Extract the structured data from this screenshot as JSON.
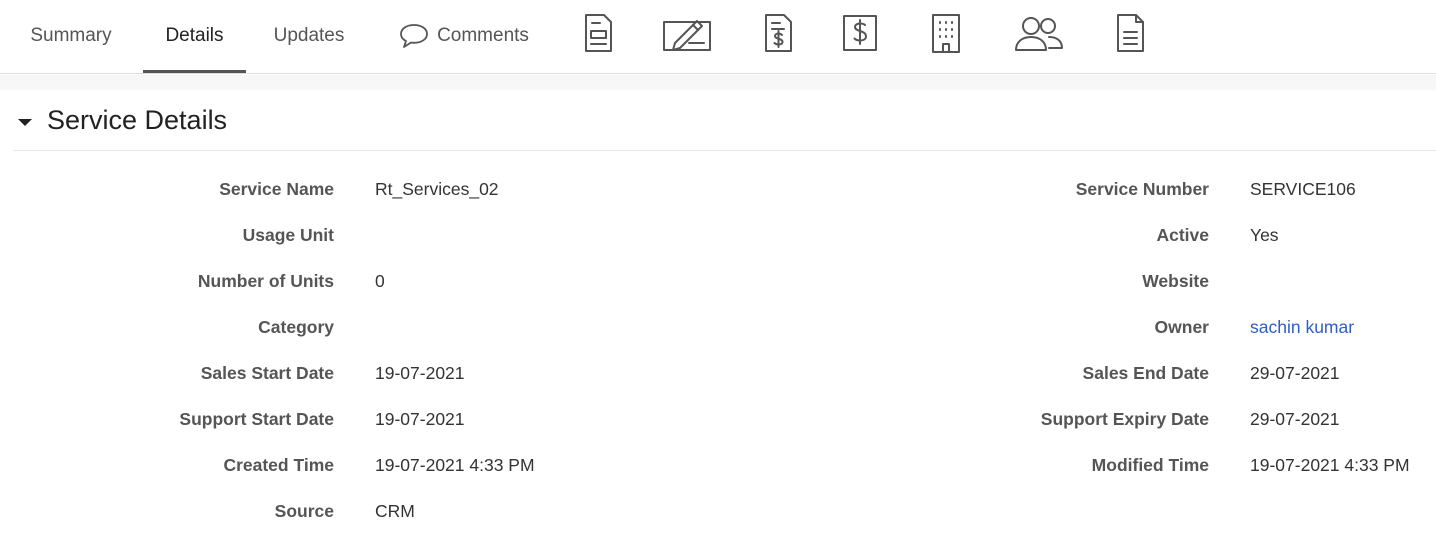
{
  "tabs": {
    "summary": "Summary",
    "details": "Details",
    "updates": "Updates",
    "comments": "Comments"
  },
  "icon_tabs": [
    "quote-document-icon",
    "signature-icon",
    "invoice-icon",
    "dollar-icon",
    "building-icon",
    "contacts-icon",
    "document-icon"
  ],
  "section": {
    "title": "Service Details"
  },
  "left_fields": [
    {
      "label": "Service Name",
      "value": "Rt_Services_02"
    },
    {
      "label": "Usage Unit",
      "value": ""
    },
    {
      "label": "Number of Units",
      "value": "0"
    },
    {
      "label": "Category",
      "value": ""
    },
    {
      "label": "Sales Start Date",
      "value": "19-07-2021"
    },
    {
      "label": "Support Start Date",
      "value": "19-07-2021"
    },
    {
      "label": "Created Time",
      "value": "19-07-2021 4:33 PM"
    },
    {
      "label": "Source",
      "value": "CRM"
    }
  ],
  "right_fields": [
    {
      "label": "Service Number",
      "value": "SERVICE106"
    },
    {
      "label": "Active",
      "value": "Yes"
    },
    {
      "label": "Website",
      "value": ""
    },
    {
      "label": "Owner",
      "value": "sachin kumar"
    },
    {
      "label": "Sales End Date",
      "value": "29-07-2021"
    },
    {
      "label": "Support Expiry Date",
      "value": "29-07-2021"
    },
    {
      "label": "Modified Time",
      "value": "19-07-2021 4:33 PM"
    }
  ],
  "colors": {
    "link": "#2f5ec7",
    "label": "#555555",
    "active_tab_underline": "#555555"
  }
}
